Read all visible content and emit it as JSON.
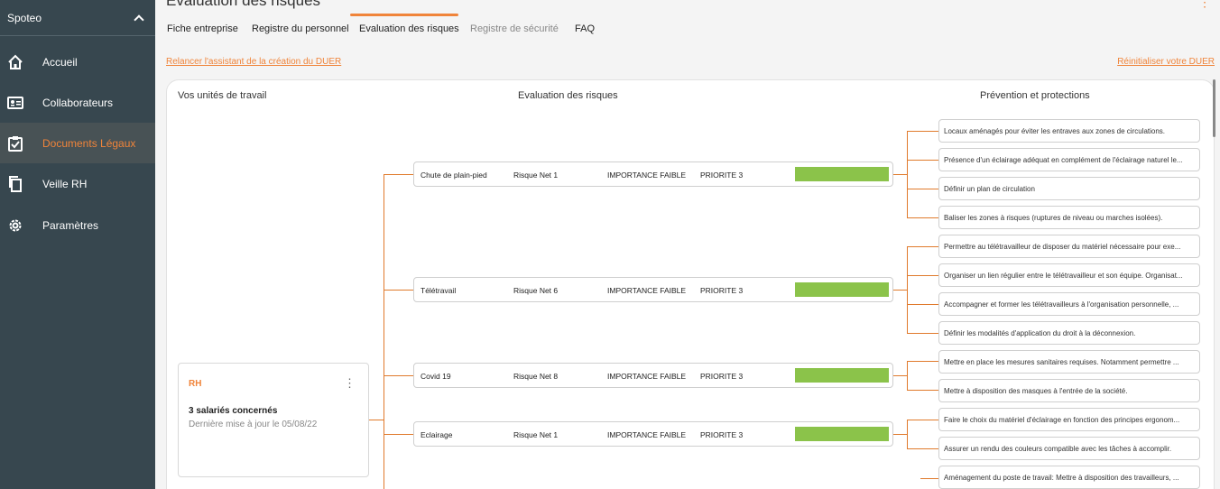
{
  "sidebar": {
    "brand": "Spoteo",
    "items": [
      {
        "label": "Accueil",
        "icon": "home-icon"
      },
      {
        "label": "Collaborateurs",
        "icon": "id-card-icon"
      },
      {
        "label": "Documents Légaux",
        "icon": "clipboard-check-icon"
      },
      {
        "label": "Veille RH",
        "icon": "copy-icon"
      },
      {
        "label": "Paramètres",
        "icon": "gear-icon"
      }
    ]
  },
  "header": {
    "title": "Evaluation des risques",
    "tabs": [
      "Fiche entreprise",
      "Registre du personnel",
      "Evaluation des risques",
      "Registre de sécurité",
      "FAQ"
    ]
  },
  "links": {
    "relaunch": "Relancer l'assistant de la création du DUER",
    "reset": "Réinitialiser votre DUER"
  },
  "columns": {
    "units": "Vos unités de travail",
    "risks": "Evaluation des risques",
    "prevention": "Prévention et protections"
  },
  "unit": {
    "name": "RH",
    "count": "3 salariés concernés",
    "updated": "Dernière mise à jour le 05/08/22"
  },
  "risks": [
    {
      "name": "Chute de plain-pied",
      "net": "Risque Net 1",
      "importance": "IMPORTANCE FAIBLE",
      "priority": "PRIORITE 3"
    },
    {
      "name": "Télétravail",
      "net": "Risque Net 6",
      "importance": "IMPORTANCE FAIBLE",
      "priority": "PRIORITE 3"
    },
    {
      "name": "Covid 19",
      "net": "Risque Net 8",
      "importance": "IMPORTANCE FAIBLE",
      "priority": "PRIORITE 3"
    },
    {
      "name": "Eclairage",
      "net": "Risque Net 1",
      "importance": "IMPORTANCE FAIBLE",
      "priority": "PRIORITE 3"
    }
  ],
  "prevention": [
    "Locaux aménagés pour éviter les entraves aux zones de circulations.",
    "Présence d'un éclairage adéquat en complément de l'éclairage naturel le...",
    "Définir un plan de circulation",
    "Baliser les zones à risques (ruptures de niveau ou marches isolées).",
    "Permettre au télétravailleur de disposer du matériel nécessaire pour exe...",
    "Organiser un lien régulier entre le télétravailleur et son équipe. Organisat...",
    "Accompagner et former les télétravailleurs à l'organisation personnelle, ...",
    "Définir les modalités d'application du droit à la déconnexion.",
    "Mettre en place les mesures sanitaires requises. Notamment permettre ...",
    "Mettre à disposition des masques à l'entrée de la société.",
    "Faire le choix du matériel d'éclairage en fonction des principes ergonom...",
    "Assurer un rendu des couleurs compatible avec les tâches à accomplir.",
    "Aménagement du poste de travail: Mettre à disposition des travailleurs, ..."
  ],
  "colors": {
    "accent": "#f0843a",
    "sidebar": "#37474f",
    "bar": "#8bc34a"
  }
}
